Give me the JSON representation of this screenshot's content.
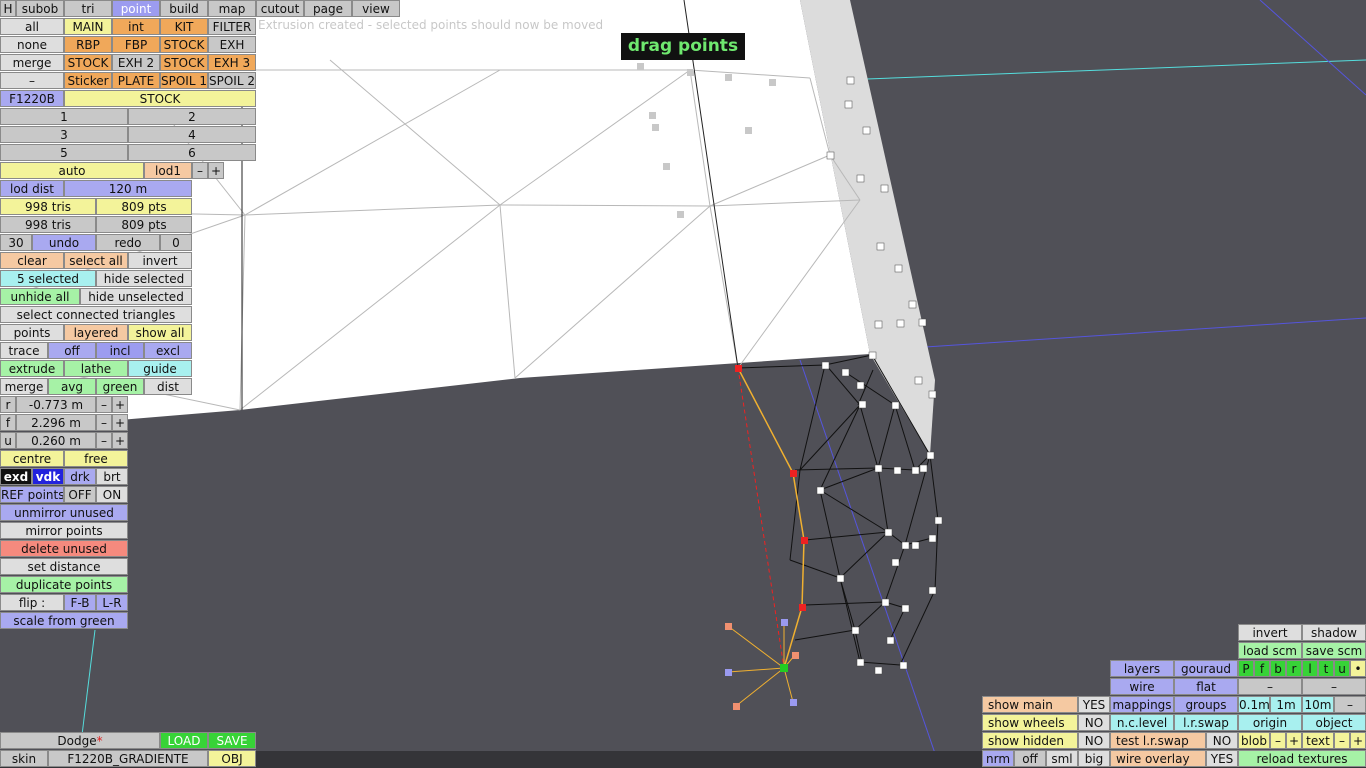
{
  "mode_tabs": [
    {
      "label": "H"
    },
    {
      "label": "subob"
    },
    {
      "label": "tri"
    },
    {
      "label": "point"
    },
    {
      "label": "build"
    },
    {
      "label": "map"
    },
    {
      "label": "cutout"
    },
    {
      "label": "page"
    },
    {
      "label": "view"
    }
  ],
  "message": "Extrusion created - selected points should now be moved",
  "overlay_hint": "drag points",
  "layers": {
    "row1": {
      "select": "all",
      "items": [
        "MAIN",
        "int",
        "KIT",
        "FILTER"
      ]
    },
    "row2": {
      "select": "none",
      "items": [
        "RBP",
        "FBP",
        "STOCK",
        "EXH"
      ]
    },
    "row3": {
      "select": "merge",
      "items": [
        "STOCK",
        "EXH 2",
        "STOCK",
        "EXH 3"
      ]
    },
    "row4": {
      "select": "–",
      "items": [
        "Sticker",
        "PLATE",
        "SPOIL 1",
        "SPOIL 2"
      ]
    }
  },
  "model": {
    "name": "F1220B",
    "variant": "STOCK"
  },
  "lod_levels": [
    "1",
    "2",
    "3",
    "4",
    "5",
    "6"
  ],
  "lod": {
    "auto": "auto",
    "current": "lod1",
    "minus": "–",
    "plus": "+",
    "dist_label": "lod dist",
    "dist_value": "120 m"
  },
  "stats": {
    "tris_a": "998 tris",
    "pts_a": "809 pts",
    "tris_b": "998 tris",
    "pts_b": "809 pts"
  },
  "history": {
    "count": "30",
    "undo": "undo",
    "redo": "redo",
    "redo_count": "0"
  },
  "selection": {
    "clear": "clear",
    "select_all": "select all",
    "invert": "invert",
    "selected": "5 selected",
    "hide_selected": "hide selected",
    "unhide_all": "unhide all",
    "hide_unselected": "hide unselected",
    "connected": "select connected triangles",
    "points": "points",
    "layered": "layered",
    "show_all": "show all"
  },
  "tools": {
    "trace": "trace",
    "off": "off",
    "incl": "incl",
    "excl": "excl",
    "extrude": "extrude",
    "lathe": "lathe",
    "guide": "guide",
    "merge": "merge",
    "avg": "avg",
    "green": "green",
    "dist": "dist"
  },
  "coords": [
    {
      "axis": "r",
      "value": "-0.773 m"
    },
    {
      "axis": "f",
      "value": "2.296 m"
    },
    {
      "axis": "u",
      "value": "0.260 m"
    }
  ],
  "pivot": {
    "centre": "centre",
    "free": "free"
  },
  "shade": {
    "exd": "exd",
    "vdk": "vdk",
    "drk": "drk",
    "brt": "brt"
  },
  "ref": {
    "label": "REF points",
    "off": "OFF",
    "on": "ON"
  },
  "actions": {
    "unmirror": "unmirror unused",
    "mirror": "mirror points",
    "delete": "delete unused",
    "set_distance": "set distance",
    "duplicate": "duplicate points",
    "flip": "flip :",
    "fb": "F-B",
    "lr": "L-R",
    "scale": "scale from green"
  },
  "file": {
    "brand": "Dodge",
    "modified": "*",
    "load": "LOAD",
    "save": "SAVE",
    "skin_label": "skin",
    "skin_name": "F1220B_GRADIENTE",
    "obj": "OBJ"
  },
  "render": {
    "invert": "invert",
    "shadow": "shadow",
    "load_scm": "load scm",
    "save_scm": "save scm",
    "flags": [
      "P",
      "f",
      "b",
      "r",
      "l",
      "t",
      "u",
      "•"
    ],
    "layers": "layers",
    "gouraud": "gouraud",
    "wire": "wire",
    "flat": "flat",
    "mappings": "mappings",
    "groups": "groups",
    "scale_a": "0.1m",
    "scale_b": "1m",
    "scale_c": "10m",
    "nclevel": "n.c.level",
    "lrswap": "l.r.swap",
    "origin": "origin",
    "object": "object",
    "test_lrswap": "test l.r.swap",
    "test_no": "NO",
    "blob": "blob",
    "text": "text",
    "wire_overlay": "wire overlay",
    "wire_overlay_yes": "YES",
    "reload": "reload textures",
    "nrm": "nrm",
    "off": "off",
    "sml": "sml",
    "big": "big",
    "dash": "–",
    "minus": "–",
    "plus": "+"
  },
  "show": [
    {
      "label": "show main",
      "value": "YES"
    },
    {
      "label": "show wheels",
      "value": "NO"
    },
    {
      "label": "show hidden",
      "value": "NO"
    }
  ],
  "colors": {
    "background": "#505057",
    "surface": "#ffffff",
    "selected_point": "#ee2222",
    "pivot": "#22cc22",
    "guide": "#f0b030",
    "axis_blue": "#5555dd",
    "axis_cyan": "#55dddd"
  }
}
